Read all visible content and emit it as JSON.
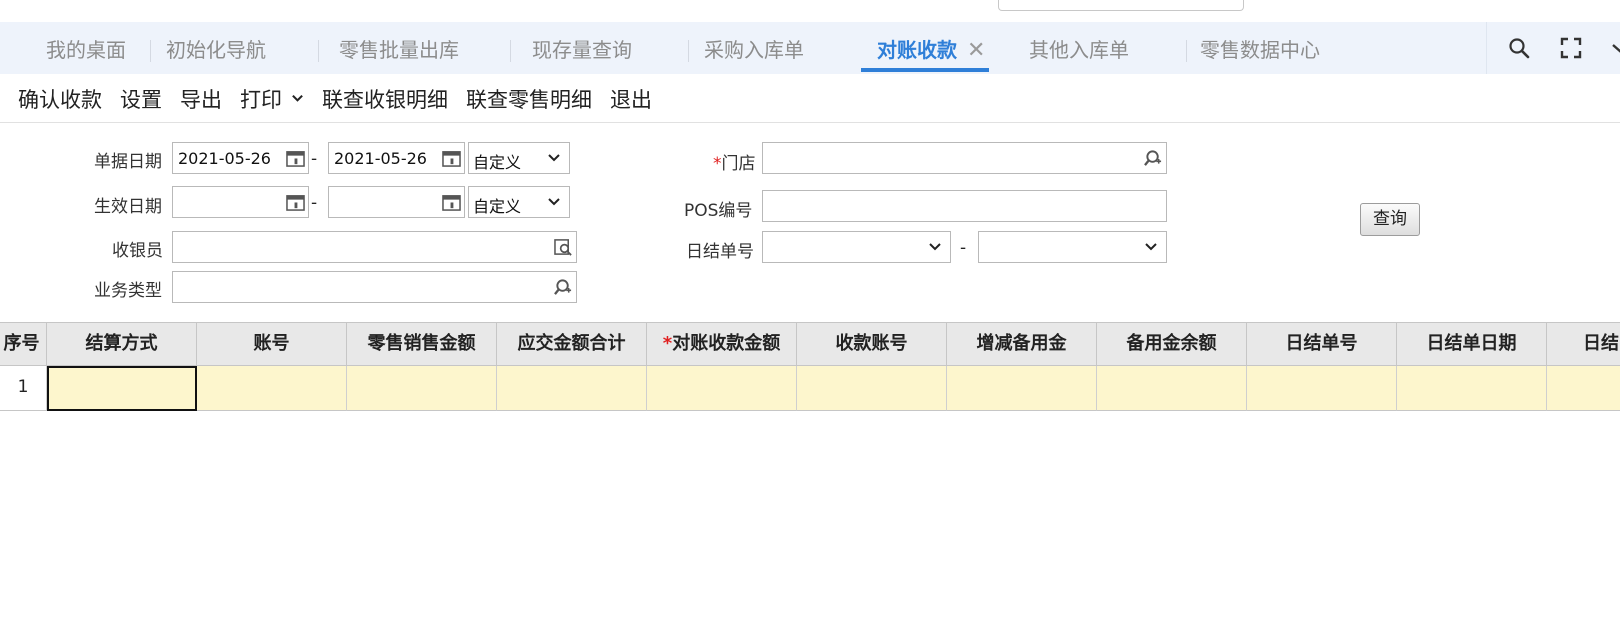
{
  "tabs": [
    {
      "label": "我的桌面"
    },
    {
      "label": "初始化导航"
    },
    {
      "label": "零售批量出库"
    },
    {
      "label": "现存量查询"
    },
    {
      "label": "采购入库单"
    },
    {
      "label": "对账收款",
      "active": true
    },
    {
      "label": "其他入库单"
    },
    {
      "label": "零售数据中心"
    }
  ],
  "tab_close_glyph": "✕",
  "tabbar_icons": [
    "search-icon",
    "fullscreen-icon",
    "chevron-down-icon"
  ],
  "toolbar": {
    "confirm": "确认收款",
    "settings": "设置",
    "export": "导出",
    "print": "打印",
    "query_cashier_detail": "联查收银明细",
    "query_retail_detail": "联查零售明细",
    "exit": "退出"
  },
  "form": {
    "doc_date_label": "单据日期",
    "doc_date_from": "2021-05-26",
    "doc_date_to": "2021-05-26",
    "doc_date_range": "自定义",
    "effective_date_label": "生效日期",
    "effective_date_from": "",
    "effective_date_to": "",
    "effective_date_range": "自定义",
    "cashier_label": "收银员",
    "cashier_value": "",
    "biz_type_label": "业务类型",
    "biz_type_value": "",
    "store_label": "门店",
    "store_required_mark": "*",
    "store_value": "",
    "pos_label": "POS编号",
    "pos_value": "",
    "daily_label": "日结单号",
    "daily_from": "",
    "daily_to": "",
    "range_dash": "-",
    "query_button": "查询"
  },
  "grid": {
    "columns": [
      "序号",
      "结算方式",
      "账号",
      "零售销售金额",
      "应交金额合计",
      "对账收款金额",
      "收款账号",
      "增减备用金",
      "备用金余额",
      "日结单号",
      "日结单日期",
      "日结"
    ],
    "required_column_mark": "*",
    "rows": [
      {
        "row_no": "1",
        "cells": [
          "",
          "",
          "",
          "",
          "",
          "",
          "",
          "",
          "",
          "",
          ""
        ]
      }
    ]
  },
  "colors": {
    "accent": "#2f7fd8",
    "row_fill": "#fdf6cd",
    "required": "#e02020"
  }
}
